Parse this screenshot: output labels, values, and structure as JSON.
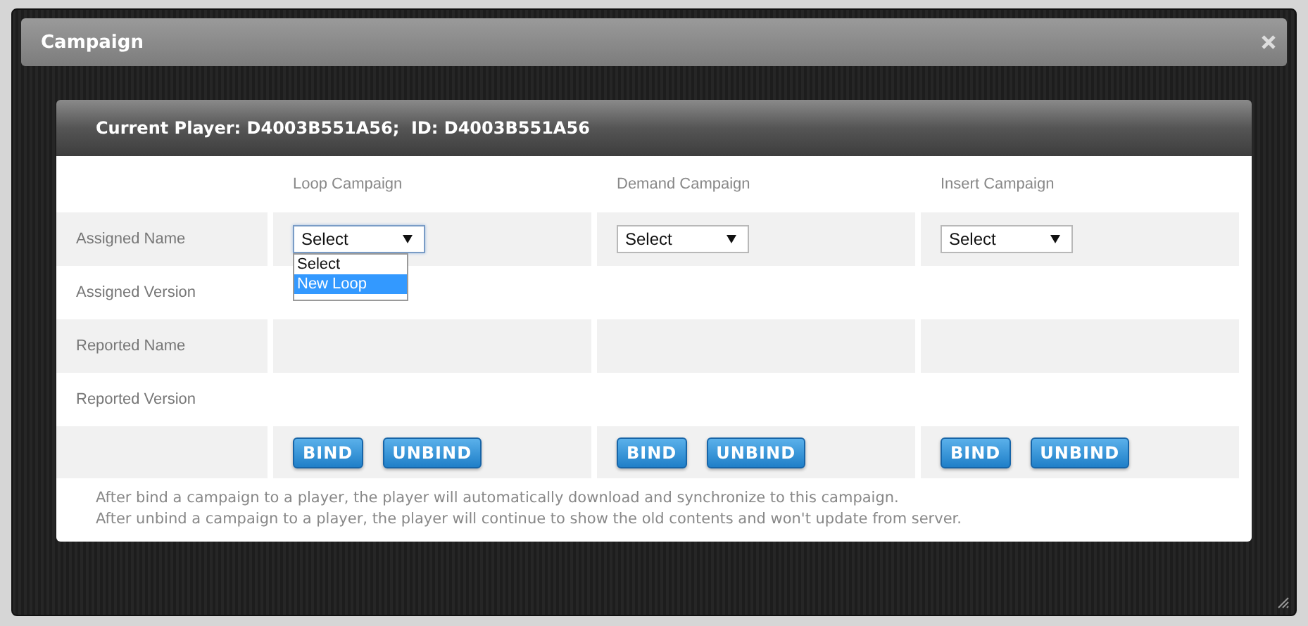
{
  "window": {
    "title": "Campaign"
  },
  "panel": {
    "header": "Current Player: D4003B551A56;  ID: D4003B551A56"
  },
  "rows": [
    "Assigned Name",
    "Assigned Version",
    "Reported Name",
    "Reported Version"
  ],
  "campaigns": [
    {
      "heading": "Loop Campaign",
      "select": {
        "value": "Select",
        "expanded": true,
        "options": [
          {
            "label": "Select",
            "highlighted": false
          },
          {
            "label": "New Loop",
            "highlighted": true
          }
        ]
      },
      "buttons": [
        "BIND",
        "UNBIND"
      ]
    },
    {
      "heading": "Demand Campaign",
      "select": {
        "value": "Select",
        "expanded": false
      },
      "buttons": [
        "BIND",
        "UNBIND"
      ]
    },
    {
      "heading": "Insert Campaign",
      "select": {
        "value": "Select",
        "expanded": false
      },
      "buttons": [
        "BIND",
        "UNBIND"
      ]
    }
  ],
  "notes": [
    "After bind a campaign to a player, the player will automatically download and synchronize to this campaign.",
    "After unbind a campaign to a player, the player will continue to show the old contents and won't update from server."
  ]
}
